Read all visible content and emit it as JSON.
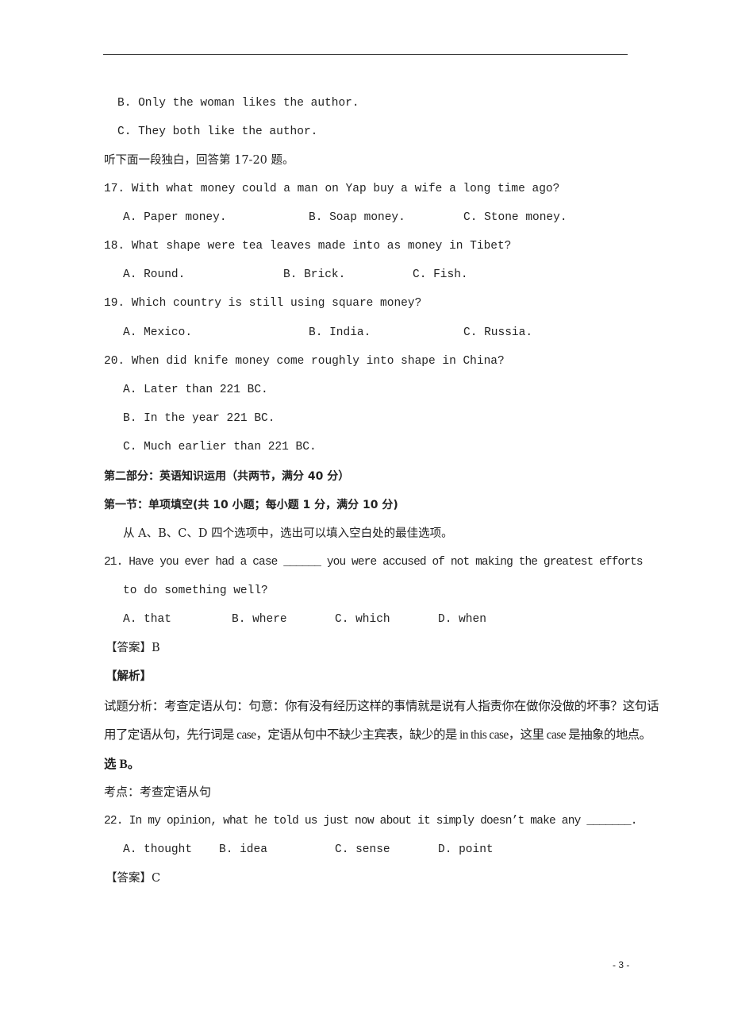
{
  "page": {
    "number": "- 3 -",
    "prev_options": [
      "B. Only the woman likes the author.",
      "C. They both like the author."
    ],
    "listening_instruction": "听下面一段独白，回答第 17-20 题。",
    "questions": [
      {
        "stem": "17. With what money could a man on Yap buy a wife a long time ago?",
        "options": [
          "A. Paper money.",
          "B. Soap money.",
          "C. Stone money."
        ]
      },
      {
        "stem": "18. What shape were tea leaves made into as money in Tibet?",
        "options": [
          "A. Round.",
          "B. Brick.",
          "C. Fish."
        ]
      },
      {
        "stem": "19. Which country is still using square money?",
        "options": [
          "A. Mexico.",
          "B. India.",
          "C. Russia."
        ]
      },
      {
        "stem": "20. When did knife money come roughly into shape in China?",
        "options": [
          "A. Later than 221 BC.",
          "B. In the year 221 BC.",
          "C. Much earlier than 221 BC."
        ]
      }
    ],
    "part2_heading": "第二部分：英语知识运用（共两节，满分 40 分）",
    "section1_heading": "第一节：单项填空(共 10 小题；每小题 1 分，满分 10 分)",
    "section1_instruction": "从 A、B、C、D 四个选项中，选出可以填入空白处的最佳选项。",
    "q21": {
      "stem_line1": "21. Have you ever had a case ______ you were accused of not making the greatest efforts",
      "stem_line2": "to do something well?",
      "options": [
        "A. that",
        "B. where",
        "C. which",
        "D. when"
      ],
      "answer": "【答案】B",
      "analysis_label": "【解析】",
      "analysis_line1": "试题分析：考查定语从句：句意：你有没有经历这样的事情就是说有人指责你在做你没做的坏事？这句话",
      "analysis_line2": "用了定语从句，先行词是 case，定语从句中不缺少主宾表，缺少的是 in this case，这里 case 是抽象的地点。",
      "analysis_line3": "选 B。",
      "keypoint": "考点：考查定语从句"
    },
    "q22": {
      "stem": "22. In my opinion, what he told us just now about it simply doesn’t make any _______.",
      "options": [
        "A. thought",
        "B. idea",
        "C. sense",
        "D. point"
      ],
      "answer": "【答案】C"
    }
  }
}
